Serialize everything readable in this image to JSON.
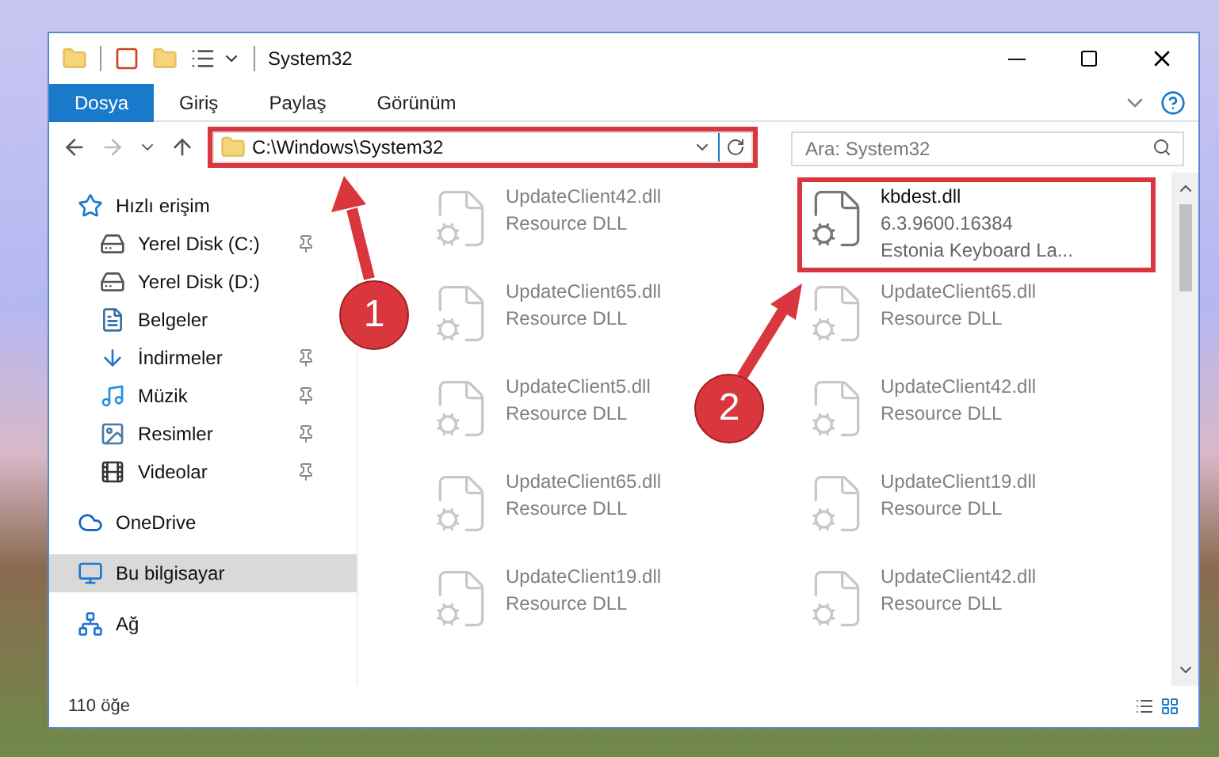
{
  "window": {
    "title": "System32"
  },
  "ribbon_tabs": [
    {
      "label": "Dosya",
      "selected": true
    },
    {
      "label": "Giriş",
      "selected": false
    },
    {
      "label": "Paylaş",
      "selected": false
    },
    {
      "label": "Görünüm",
      "selected": false
    }
  ],
  "address": {
    "path": "C:\\Windows\\System32",
    "highlighted": true
  },
  "search": {
    "placeholder": "Ara: System32"
  },
  "sidebar": {
    "items": [
      {
        "label": "Hızlı erişim",
        "kind": "quick",
        "selected": false,
        "children": [
          {
            "label": "Yerel Disk (C:)",
            "kind": "drive",
            "pinned": true
          },
          {
            "label": "Yerel Disk (D:)",
            "kind": "drive",
            "pinned": false
          },
          {
            "label": "Belgeler",
            "kind": "documents",
            "pinned": false
          },
          {
            "label": "İndirmeler",
            "kind": "downloads",
            "pinned": true
          },
          {
            "label": "Müzik",
            "kind": "music",
            "pinned": true
          },
          {
            "label": "Resimler",
            "kind": "pictures",
            "pinned": true
          },
          {
            "label": "Videolar",
            "kind": "videos",
            "pinned": true
          }
        ]
      },
      {
        "label": "OneDrive",
        "kind": "cloud",
        "selected": false
      },
      {
        "label": "Bu bilgisayar",
        "kind": "computer",
        "selected": true
      },
      {
        "label": "Ağ",
        "kind": "network",
        "selected": false
      }
    ]
  },
  "files": [
    {
      "name": "UpdateClient42.dll",
      "detail": "Resource DLL",
      "faded": true,
      "highlighted": false
    },
    {
      "name": "kbdest.dll",
      "version": "6.3.9600.16384",
      "detail": "Estonia Keyboard La...",
      "faded": false,
      "highlighted": true
    },
    {
      "name": "UpdateClient65.dll",
      "detail": "Resource DLL",
      "faded": true,
      "highlighted": false
    },
    {
      "name": "UpdateClient65.dll",
      "detail": "Resource DLL",
      "faded": true,
      "highlighted": false
    },
    {
      "name": "UpdateClient5.dll",
      "detail": "Resource DLL",
      "faded": true,
      "highlighted": false
    },
    {
      "name": "UpdateClient42.dll",
      "detail": "Resource DLL",
      "faded": true,
      "highlighted": false
    },
    {
      "name": "UpdateClient65.dll",
      "detail": "Resource DLL",
      "faded": true,
      "highlighted": false
    },
    {
      "name": "UpdateClient19.dll",
      "detail": "Resource DLL",
      "faded": true,
      "highlighted": false
    },
    {
      "name": "UpdateClient19.dll",
      "detail": "Resource DLL",
      "faded": true,
      "highlighted": false
    },
    {
      "name": "UpdateClient42.dll",
      "detail": "Resource DLL",
      "faded": true,
      "highlighted": false
    }
  ],
  "status_bar": {
    "count": "110 öğe"
  },
  "annotations": [
    {
      "label": "1"
    },
    {
      "label": "2"
    }
  ]
}
